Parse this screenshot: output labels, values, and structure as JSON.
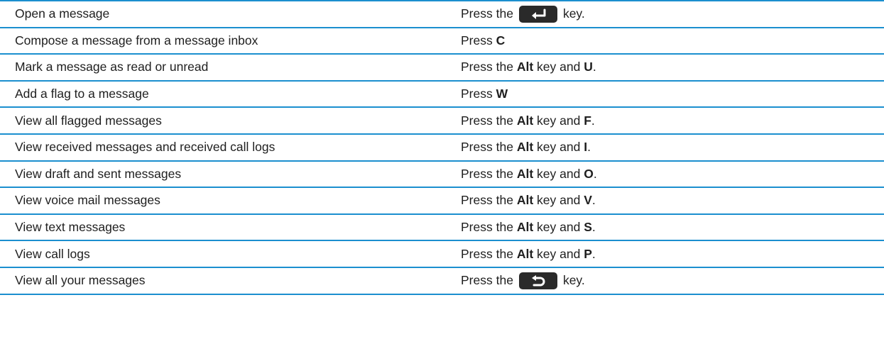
{
  "rows": [
    {
      "action": "Open a message",
      "pre": "Press the",
      "bold": "",
      "mid": "",
      "bold2": "",
      "post": "key.",
      "key_icon": "enter-key-icon"
    },
    {
      "action": "Compose a message from a message inbox",
      "pre": "Press",
      "bold": "C",
      "mid": "",
      "bold2": "",
      "post": ""
    },
    {
      "action": "Mark a message as read or unread",
      "pre": "Press the",
      "bold": "Alt",
      "mid": "key and",
      "bold2": "U",
      "post": "."
    },
    {
      "action": "Add a flag to a message",
      "pre": "Press",
      "bold": "W",
      "mid": "",
      "bold2": "",
      "post": ""
    },
    {
      "action": "View all flagged messages",
      "pre": "Press the",
      "bold": "Alt",
      "mid": "key and",
      "bold2": "F",
      "post": "."
    },
    {
      "action": "View received messages and received call logs",
      "pre": "Press the",
      "bold": "Alt",
      "mid": "key and",
      "bold2": "I",
      "post": "."
    },
    {
      "action": "View draft and sent messages",
      "pre": "Press the",
      "bold": "Alt",
      "mid": "key and",
      "bold2": "O",
      "post": "."
    },
    {
      "action": "View voice mail messages",
      "pre": "Press the",
      "bold": "Alt",
      "mid": "key and",
      "bold2": "V",
      "post": "."
    },
    {
      "action": "View text messages",
      "pre": "Press the",
      "bold": "Alt",
      "mid": "key and",
      "bold2": "S",
      "post": "."
    },
    {
      "action": "View call logs",
      "pre": "Press the",
      "bold": "Alt",
      "mid": "key and",
      "bold2": "P",
      "post": "."
    },
    {
      "action": "View all your messages",
      "pre": "Press the",
      "bold": "",
      "mid": "",
      "bold2": "",
      "post": "key.",
      "key_icon": "escape-key-icon"
    }
  ],
  "colors": {
    "rule": "#1b8fcf",
    "key_bg": "#2a2a2a",
    "text": "#1f1f1f"
  }
}
